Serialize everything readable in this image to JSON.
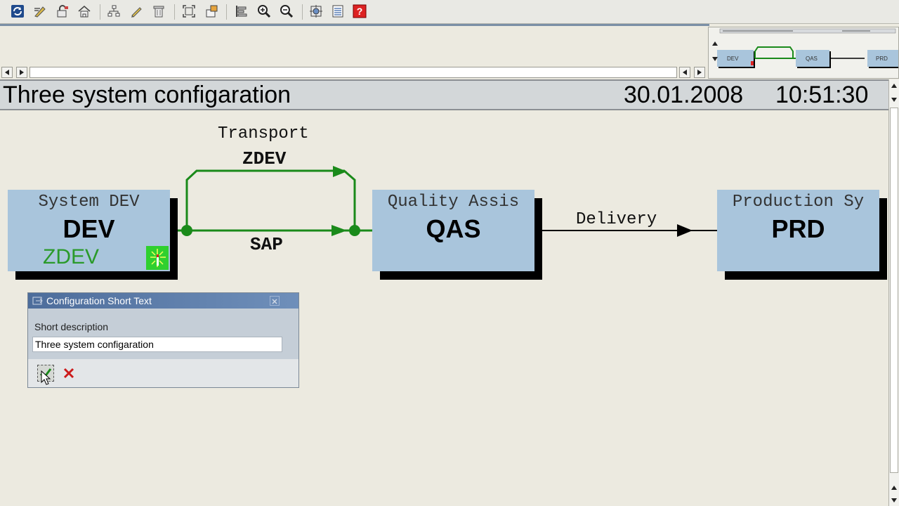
{
  "toolbar": {
    "icons": [
      "refresh-icon",
      "edit-icon",
      "lock-icon",
      "home-icon",
      "hierarchy-icon",
      "pencil-icon",
      "trash-icon",
      "fit-screen-icon",
      "export-icon",
      "align-icon",
      "zoom-in-icon",
      "zoom-out-icon",
      "settings-icon",
      "list-icon",
      "help-icon"
    ]
  },
  "header": {
    "title": "Three system configaration",
    "date": "30.01.2008",
    "time": "10:51:30"
  },
  "overview": {
    "nodes": [
      "DEV",
      "QAS",
      "PRD"
    ]
  },
  "diagram": {
    "nodes": [
      {
        "label": "System DEV",
        "id": "DEV",
        "sub": "ZDEV"
      },
      {
        "label": "Quality Assis",
        "id": "QAS"
      },
      {
        "label": "Production Sy",
        "id": "PRD"
      }
    ],
    "routes": {
      "transport_label": "Transport",
      "transport_layer": "ZDEV",
      "sap_layer": "SAP",
      "delivery_label": "Delivery"
    },
    "colors": {
      "node": "#a9c5dc",
      "transport": "#1a8a1a",
      "delivery": "#000000",
      "sub_text": "#2a9a2a"
    }
  },
  "dialog": {
    "title": "Configuration Short Text",
    "field_label": "Short description",
    "field_value": "Three system configaration",
    "confirm_icon": "check-icon",
    "cancel_icon": "cancel-icon"
  }
}
